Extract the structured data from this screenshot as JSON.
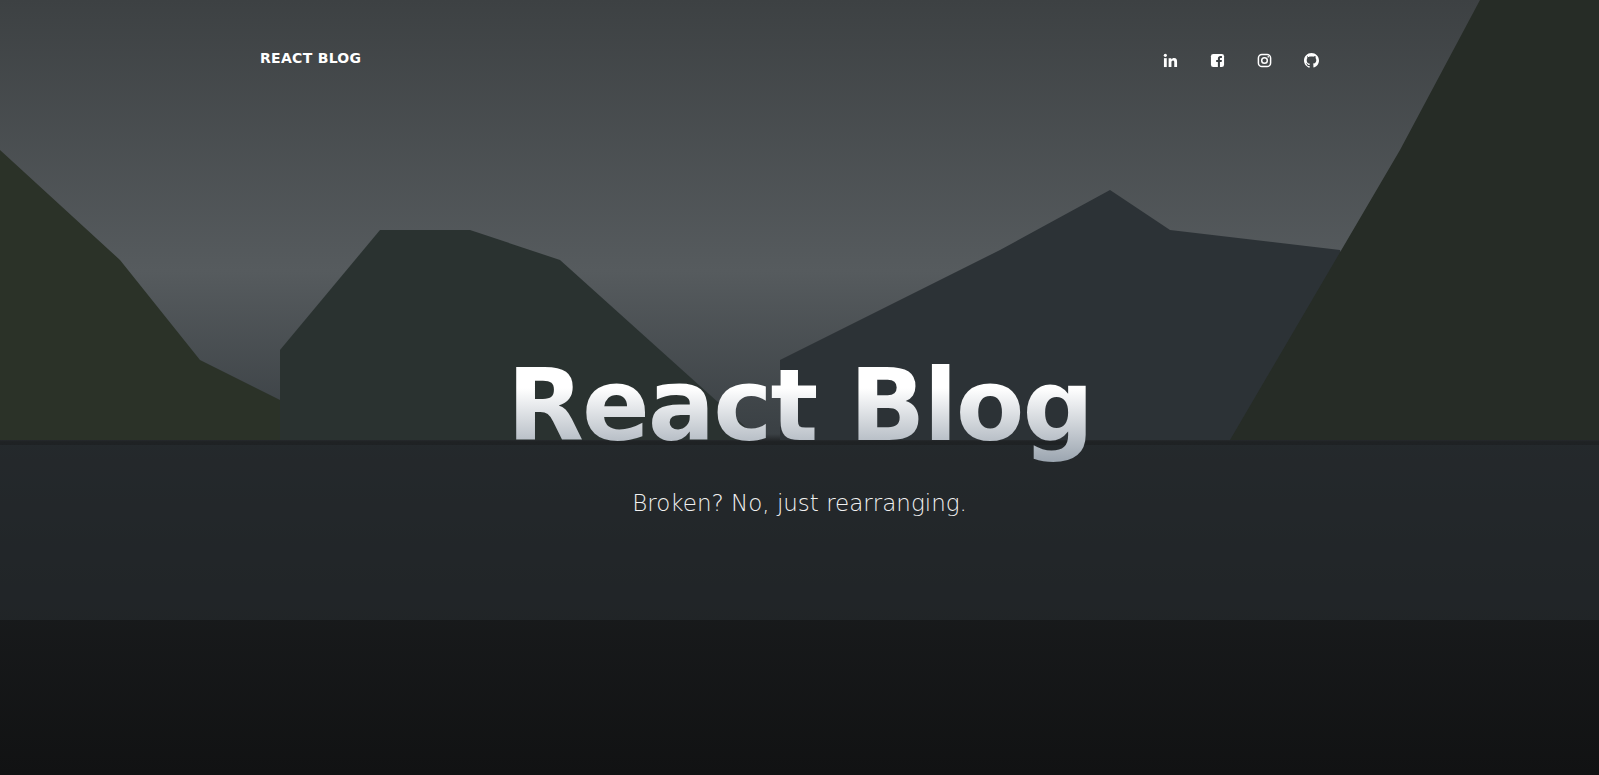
{
  "header": {
    "brand": "REACT BLOG"
  },
  "hero": {
    "title": "React Blog",
    "subtitle": "Broken? No, just rearranging."
  }
}
